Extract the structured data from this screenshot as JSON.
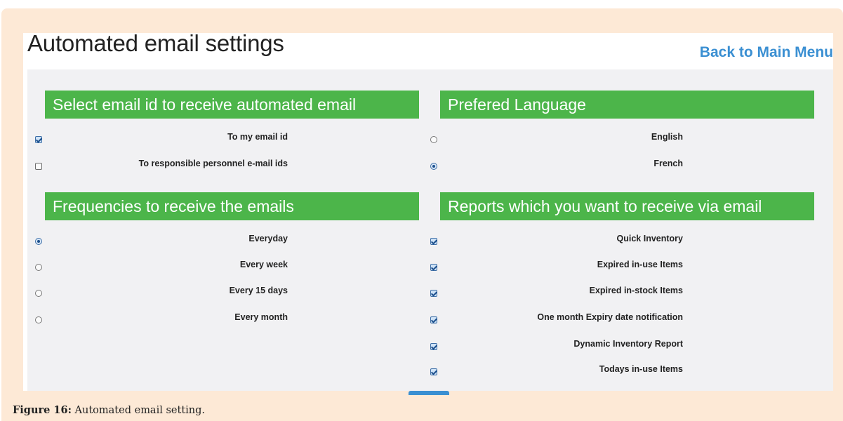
{
  "header": {
    "title": "Automated email settings",
    "back_link": "Back to Main Menu"
  },
  "sections": {
    "email_target": {
      "title": "Select email id to receive automated email",
      "options": [
        {
          "label": "To my email id",
          "checked": true
        },
        {
          "label": "To responsible personnel e-mail ids",
          "checked": false
        }
      ]
    },
    "language": {
      "title": "Prefered Language",
      "options": [
        {
          "label": "English",
          "selected": false
        },
        {
          "label": "French",
          "selected": true
        }
      ]
    },
    "frequency": {
      "title": "Frequencies to receive the emails",
      "options": [
        {
          "label": "Everyday",
          "selected": true
        },
        {
          "label": "Every week",
          "selected": false
        },
        {
          "label": "Every 15 days",
          "selected": false
        },
        {
          "label": "Every month",
          "selected": false
        }
      ]
    },
    "reports": {
      "title": "Reports which you want to receive via email",
      "options": [
        {
          "label": "Quick Inventory",
          "checked": true
        },
        {
          "label": "Expired in-use Items",
          "checked": true
        },
        {
          "label": "Expired in-stock Items",
          "checked": true
        },
        {
          "label": "One month Expiry date notification",
          "checked": true
        },
        {
          "label": "Dynamic Inventory Report",
          "checked": true
        },
        {
          "label": "Todays in-use Items",
          "checked": true
        }
      ]
    }
  },
  "caption": {
    "label": "Figure 16:",
    "text": " Automated email setting."
  },
  "colors": {
    "section_header": "#4cb54a",
    "link": "#3a8fd2",
    "frame_background": "#fde9d6",
    "panel_background": "#f1f1f3"
  }
}
